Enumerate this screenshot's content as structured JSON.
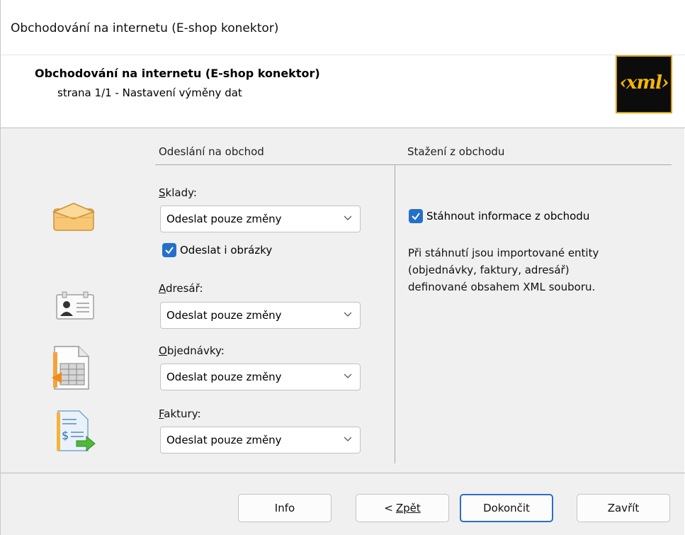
{
  "window": {
    "title": "Obchodování na internetu (E-shop konektor)"
  },
  "header": {
    "title": "Obchodování na internetu (E-shop konektor)",
    "subtitle": "strana 1/1 - Nastavení výměny dat",
    "logo_text": "‹xml›"
  },
  "send": {
    "column_title": "Odeslání na obchod",
    "warehouses": {
      "label_key": "S",
      "label_rest": "klady:",
      "value": "Odeslat pouze změny"
    },
    "send_images": {
      "label": "Odeslat i obrázky",
      "checked": true
    },
    "address_book": {
      "label_key": "A",
      "label_rest": "dresář:",
      "value": "Odeslat pouze změny"
    },
    "orders": {
      "label_key": "O",
      "label_rest": "bjednávky:",
      "value": "Odeslat pouze změny"
    },
    "invoices": {
      "label_key": "F",
      "label_rest": "aktury:",
      "value": "Odeslat pouze změny"
    }
  },
  "download": {
    "column_title": "Stažení z obchodu",
    "download_info": {
      "label": "Stáhnout informace z obchodu",
      "checked": true
    },
    "description_lines": [
      "Při stáhnutí jsou importované entity",
      "(objednávky, faktury, adresář)",
      "definované obsahem XML souboru."
    ]
  },
  "buttons": {
    "info": "Info",
    "back": "< Zpět",
    "finish": "Dokončit",
    "close": "Zavřít"
  },
  "colors": {
    "accent": "#2470c9",
    "logo_bg": "#0c0c0c",
    "logo_fg": "#f5b800"
  }
}
